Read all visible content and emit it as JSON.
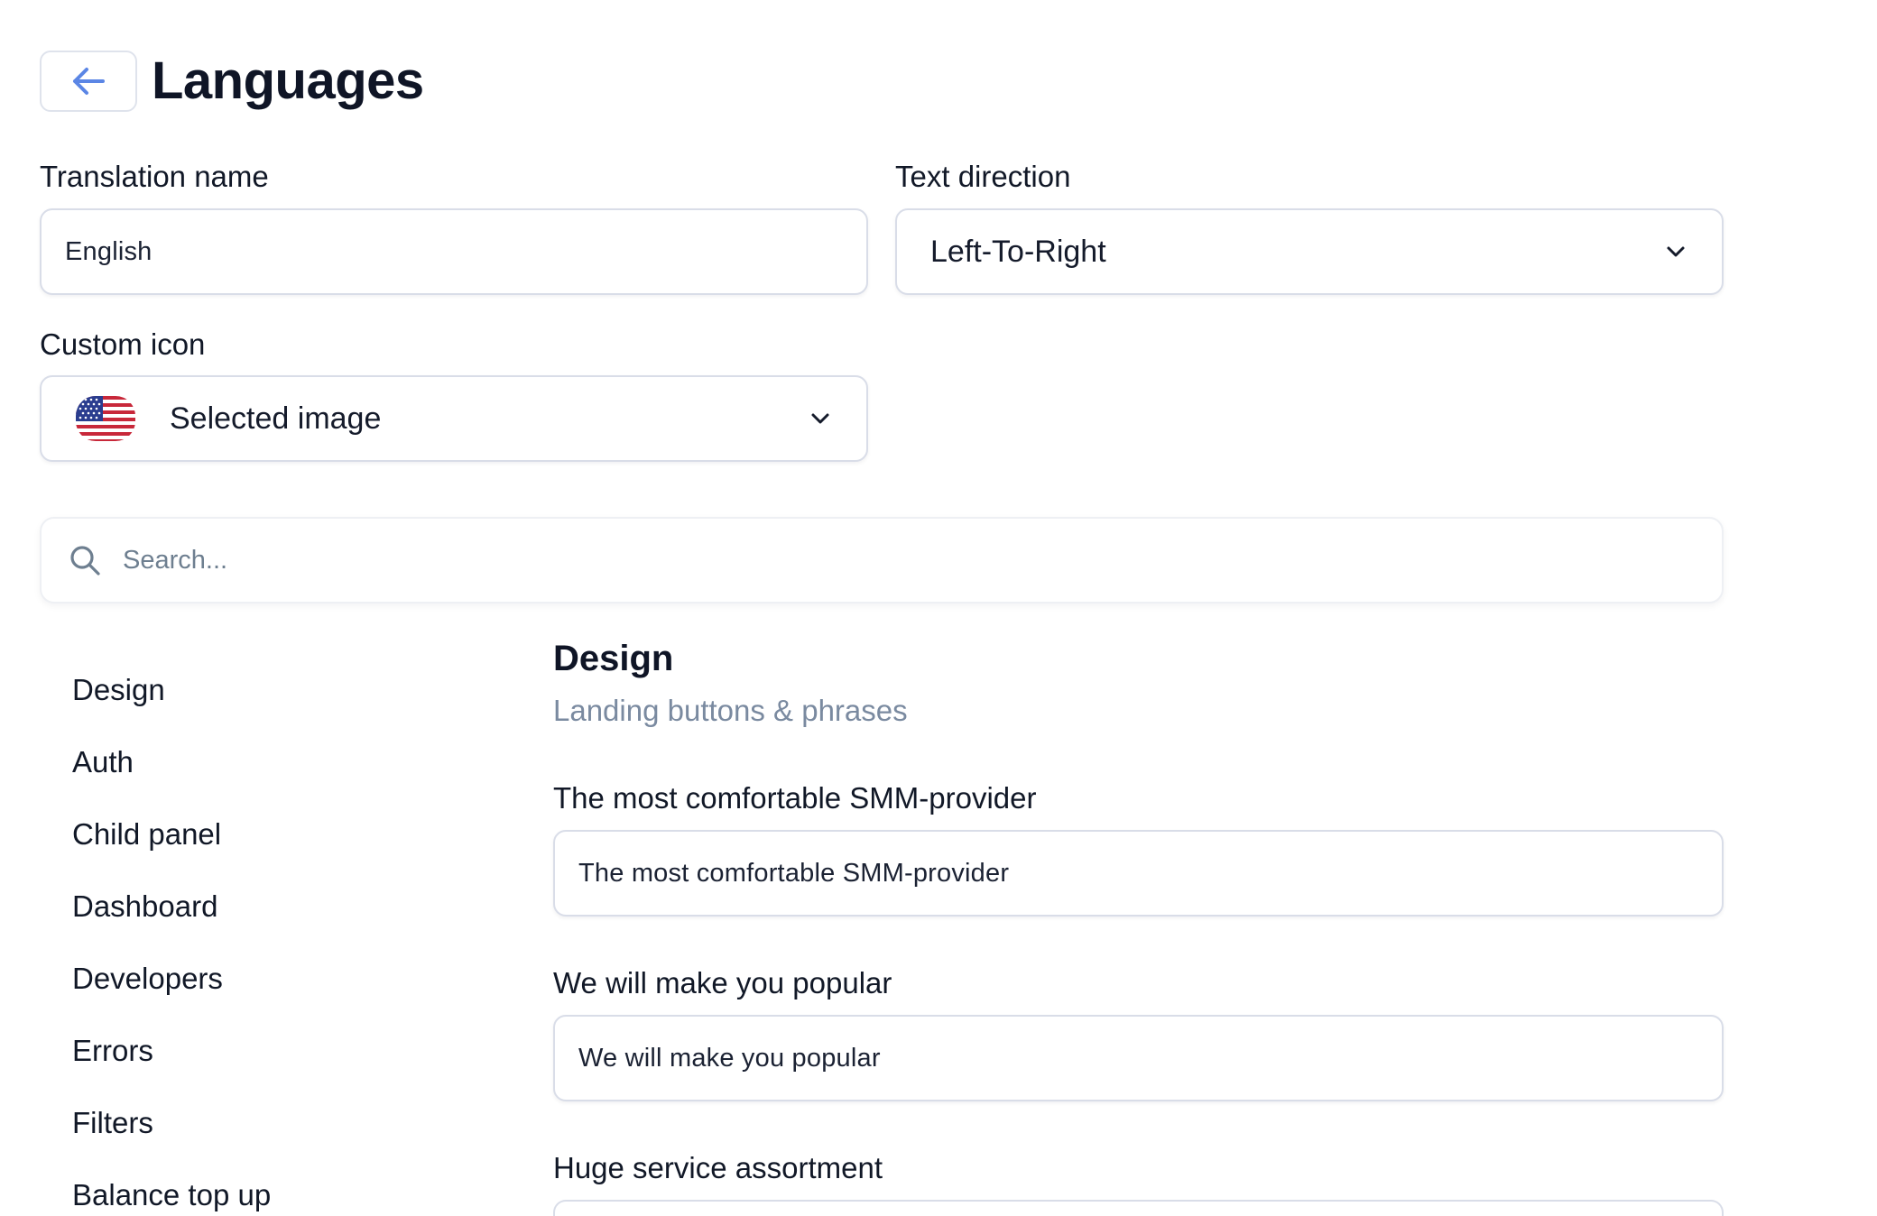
{
  "header": {
    "title": "Languages"
  },
  "translation_name": {
    "label": "Translation name",
    "value": "English"
  },
  "text_direction": {
    "label": "Text direction",
    "value": "Left-To-Right"
  },
  "custom_icon": {
    "label": "Custom icon",
    "value": "Selected image",
    "icon": "us-flag-icon"
  },
  "search": {
    "placeholder": "Search..."
  },
  "sidebar": {
    "items": [
      {
        "label": "Design"
      },
      {
        "label": "Auth"
      },
      {
        "label": "Child panel"
      },
      {
        "label": "Dashboard"
      },
      {
        "label": "Developers"
      },
      {
        "label": "Errors"
      },
      {
        "label": "Filters"
      },
      {
        "label": "Balance top up"
      }
    ]
  },
  "section": {
    "title": "Design",
    "subtitle": "Landing buttons & phrases",
    "fields": [
      {
        "label": "The most comfortable SMM-provider",
        "value": "The most comfortable SMM-provider"
      },
      {
        "label": "We will make you popular",
        "value": "We will make you popular"
      },
      {
        "label": "Huge service assortment",
        "value": ""
      }
    ]
  },
  "colors": {
    "accent": "#5b86e5",
    "title_text": "#0f1526",
    "muted_text": "#7a8aa0",
    "border": "#d9dde8"
  }
}
